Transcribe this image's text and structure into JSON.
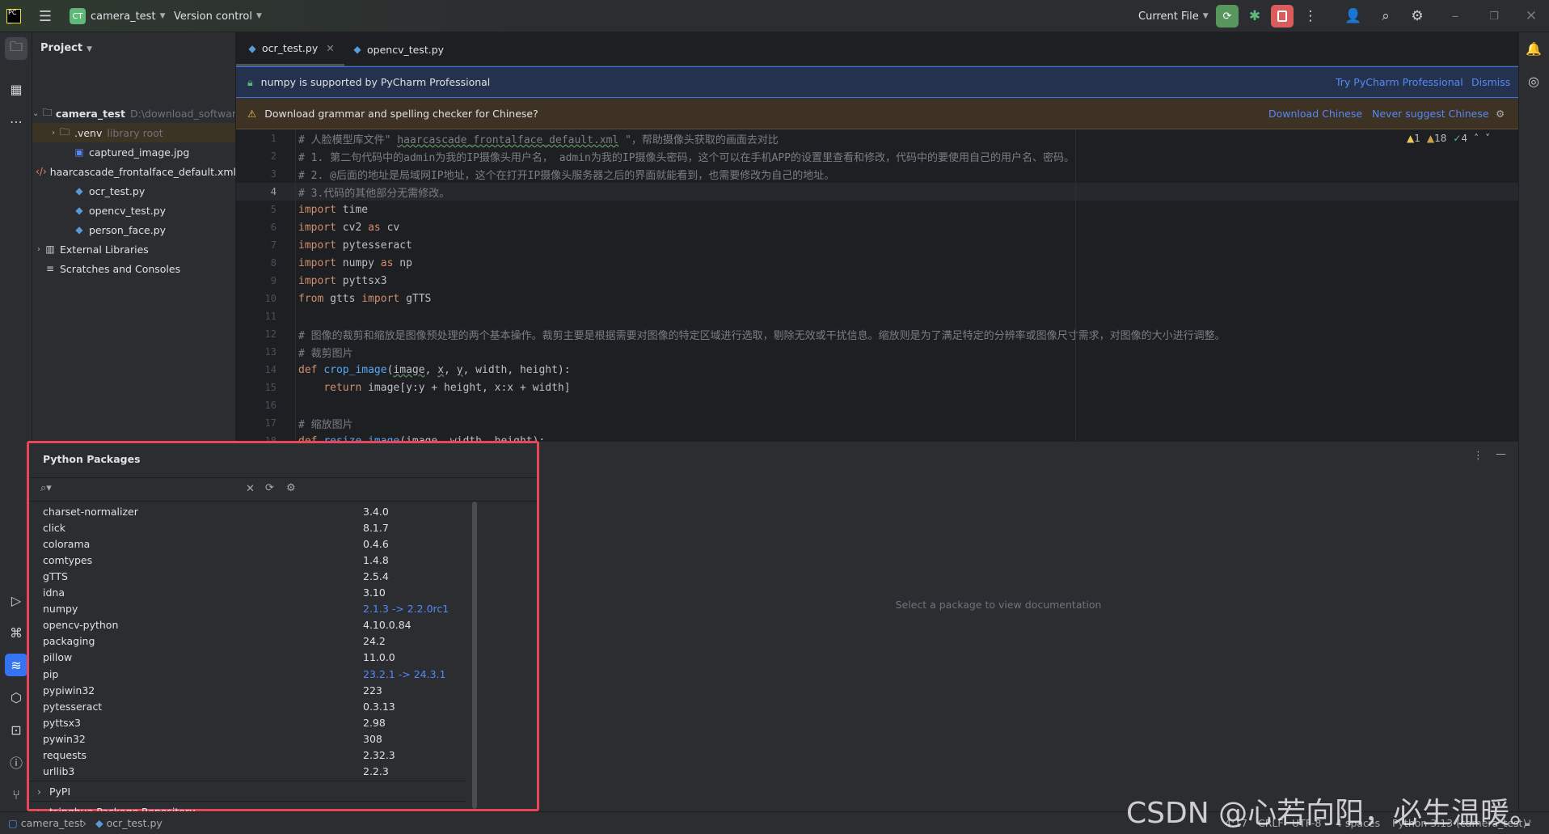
{
  "titlebar": {
    "project_badge": "CT",
    "project": "camera_test",
    "vcs": "Version control",
    "run_config": "Current File"
  },
  "project_panel": {
    "title": "Project",
    "tree": [
      {
        "label": "camera_test",
        "hint": "D:\\download_softwar",
        "icon": "folder-icon",
        "depth": 0,
        "expand": "v"
      },
      {
        "label": ".venv",
        "hint": "library root",
        "icon": "folder-icon",
        "depth": 1,
        "expand": ">"
      },
      {
        "label": "captured_image.jpg",
        "hint": "",
        "icon": "image-file-icon",
        "depth": 2,
        "expand": ""
      },
      {
        "label": "haarcascade_frontalface_default.xml",
        "hint": "",
        "icon": "xml-file-icon",
        "depth": 2,
        "expand": ""
      },
      {
        "label": "ocr_test.py",
        "hint": "",
        "icon": "python-file-icon",
        "depth": 2,
        "expand": ""
      },
      {
        "label": "opencv_test.py",
        "hint": "",
        "icon": "python-file-icon",
        "depth": 2,
        "expand": ""
      },
      {
        "label": "person_face.py",
        "hint": "",
        "icon": "python-file-icon",
        "depth": 2,
        "expand": ""
      },
      {
        "label": "External Libraries",
        "hint": "",
        "icon": "library-icon",
        "depth": 0,
        "expand": ">"
      },
      {
        "label": "Scratches and Consoles",
        "hint": "",
        "icon": "scratches-icon",
        "depth": 0,
        "expand": ""
      }
    ]
  },
  "tabs": [
    {
      "label": "ocr_test.py",
      "active": true
    },
    {
      "label": "opencv_test.py",
      "active": false
    }
  ],
  "banners": {
    "pro": {
      "text": "numpy is supported by PyCharm Professional",
      "actions": [
        "Try PyCharm Professional",
        "Dismiss"
      ]
    },
    "grammar": {
      "text": "Download grammar and spelling checker for Chinese?",
      "actions": [
        "Download Chinese",
        "Never suggest Chinese"
      ]
    }
  },
  "inspections": {
    "errors": "1",
    "warnings": "18",
    "typos": "4"
  },
  "editor": {
    "current_line": 4,
    "lines": [
      [
        [
          "cm",
          "# 人脸模型库文件\" "
        ],
        [
          "cm ul",
          "haarcascade_frontalface_default.xml"
        ],
        [
          "cm",
          " \"，帮助摄像头获取的画面去对比"
        ]
      ],
      [
        [
          "cm",
          "# 1. 第二句代码中的admin为我的IP摄像头用户名， admin为我的IP摄像头密码，这个可以在手机APP的设置里查看和修改，代码中的要使用自己的用户名、密码。"
        ]
      ],
      [
        [
          "cm",
          "# 2. @后面的地址是局域网IP地址，这个在打开IP摄像头服务器之后的界面就能看到，也需要修改为自己的地址。"
        ]
      ],
      [
        [
          "cm",
          "# 3.代码的其他部分无需修改。"
        ]
      ],
      [
        [
          "kw",
          "import"
        ],
        [
          "tx",
          " time"
        ]
      ],
      [
        [
          "kw",
          "import"
        ],
        [
          "tx",
          " cv2 "
        ],
        [
          "kw",
          "as"
        ],
        [
          "tx",
          " cv"
        ]
      ],
      [
        [
          "kw",
          "import"
        ],
        [
          "tx",
          " pytesseract"
        ]
      ],
      [
        [
          "kw",
          "import"
        ],
        [
          "tx",
          " numpy "
        ],
        [
          "kw",
          "as"
        ],
        [
          "tx",
          " np"
        ]
      ],
      [
        [
          "kw",
          "import"
        ],
        [
          "tx",
          " pyttsx3"
        ]
      ],
      [
        [
          "kw",
          "from"
        ],
        [
          "tx",
          " gtts "
        ],
        [
          "kw",
          "import"
        ],
        [
          "tx",
          " gTTS"
        ]
      ],
      [],
      [
        [
          "cm",
          "# 图像的裁剪和缩放是图像预处理的两个基本操作。裁剪主要是根据需要对图像的特定区域进行选取，剔除无效或干扰信息。缩放则是为了满足特定的分辨率或图像尺寸需求，对图像的大小进行调整。"
        ]
      ],
      [
        [
          "cm",
          "# 裁剪图片"
        ]
      ],
      [
        [
          "kw",
          "def"
        ],
        [
          "tx",
          " "
        ],
        [
          "fn",
          "crop_image"
        ],
        [
          "tx",
          "("
        ],
        [
          "tx ul",
          "image"
        ],
        [
          "tx",
          ", "
        ],
        [
          "tx ul",
          "x"
        ],
        [
          "tx",
          ", "
        ],
        [
          "tx ul",
          "y"
        ],
        [
          "tx",
          ", width, height):"
        ]
      ],
      [
        [
          "tx",
          "    "
        ],
        [
          "kw",
          "return"
        ],
        [
          "tx",
          " image[y:y + height, x:x + width]"
        ]
      ],
      [],
      [
        [
          "cm",
          "# 缩放图片"
        ]
      ],
      [
        [
          "kw",
          "def"
        ],
        [
          "tx",
          " "
        ],
        [
          "fn",
          "resize_image"
        ],
        [
          "tx",
          "(image, width, height):"
        ]
      ]
    ]
  },
  "packages": {
    "title": "Python Packages",
    "installed": [
      {
        "name": "charset-normalizer",
        "version": "3.4.0",
        "update": false
      },
      {
        "name": "click",
        "version": "8.1.7",
        "update": false
      },
      {
        "name": "colorama",
        "version": "0.4.6",
        "update": false
      },
      {
        "name": "comtypes",
        "version": "1.4.8",
        "update": false
      },
      {
        "name": "gTTS",
        "version": "2.5.4",
        "update": false
      },
      {
        "name": "idna",
        "version": "3.10",
        "update": false
      },
      {
        "name": "numpy",
        "version": "2.1.3 -> 2.2.0rc1",
        "update": true
      },
      {
        "name": "opencv-python",
        "version": "4.10.0.84",
        "update": false
      },
      {
        "name": "packaging",
        "version": "24.2",
        "update": false
      },
      {
        "name": "pillow",
        "version": "11.0.0",
        "update": false
      },
      {
        "name": "pip",
        "version": "23.2.1 -> 24.3.1",
        "update": true
      },
      {
        "name": "pypiwin32",
        "version": "223",
        "update": false
      },
      {
        "name": "pytesseract",
        "version": "0.3.13",
        "update": false
      },
      {
        "name": "pyttsx3",
        "version": "2.98",
        "update": false
      },
      {
        "name": "pywin32",
        "version": "308",
        "update": false
      },
      {
        "name": "requests",
        "version": "2.32.3",
        "update": false
      },
      {
        "name": "urllib3",
        "version": "2.2.3",
        "update": false
      }
    ],
    "repositories": [
      "PyPI",
      "tsinghua Package Repository"
    ],
    "doc_placeholder": "Select a package to view documentation"
  },
  "statusbar": {
    "breadcrumb": [
      "camera_test",
      "ocr_test.py"
    ],
    "position": "4:17",
    "line_sep": "CRLF",
    "encoding": "UTF-8",
    "indent": "4 spaces",
    "interpreter": "Python 3.13 (camera_test)"
  },
  "watermark": "CSDN @心若向阳，必生温暖。",
  "colors": {
    "accent": "#3574f0",
    "highlight_border": "#e8475a",
    "run": "#57965c",
    "stop": "#db5c5c",
    "link": "#548af7"
  }
}
